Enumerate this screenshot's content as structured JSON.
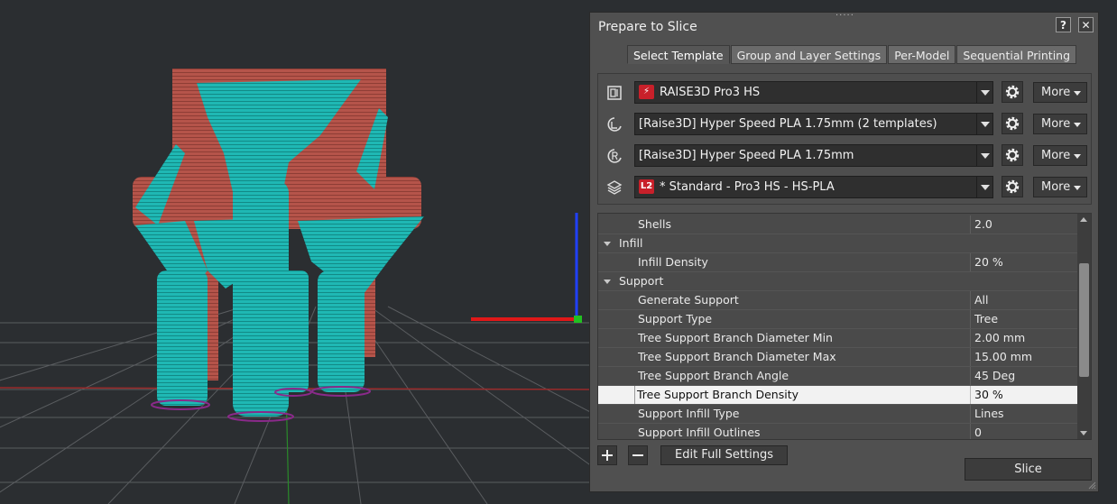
{
  "dialog": {
    "title": "Prepare to Slice",
    "help_label": "?",
    "close_label": "✕",
    "tabs": [
      {
        "label": "Select Template",
        "active": true
      },
      {
        "label": "Group and Layer Settings",
        "active": false
      },
      {
        "label": "Per-Model",
        "active": false
      },
      {
        "label": "Sequential Printing",
        "active": false
      }
    ]
  },
  "templates": {
    "printer": {
      "value": "RAISE3D Pro3 HS",
      "badge": "⚡",
      "icon": "printer-icon",
      "more_label": "More"
    },
    "material": {
      "value": "[Raise3D] Hyper Speed PLA 1.75mm (2 templates)",
      "icon": "material-left-icon",
      "more_label": "More"
    },
    "material_right": {
      "value": "[Raise3D] Hyper Speed PLA 1.75mm",
      "icon": "material-right-icon",
      "more_label": "More"
    },
    "profile": {
      "value": "* Standard - Pro3 HS - HS-PLA",
      "badge": "L2",
      "icon": "layers-icon",
      "more_label": "More"
    }
  },
  "settings": {
    "rows": [
      {
        "type": "setting",
        "label": "Shells",
        "value": "2.0"
      },
      {
        "type": "category",
        "label": "Infill"
      },
      {
        "type": "setting",
        "label": "Infill Density",
        "value": "20 %"
      },
      {
        "type": "category",
        "label": "Support"
      },
      {
        "type": "setting",
        "label": "Generate Support",
        "value": "All"
      },
      {
        "type": "setting",
        "label": "Support Type",
        "value": "Tree"
      },
      {
        "type": "setting",
        "label": "Tree Support Branch Diameter Min",
        "value": "2.00 mm"
      },
      {
        "type": "setting",
        "label": "Tree Support Branch Diameter Max",
        "value": "15.00 mm"
      },
      {
        "type": "setting",
        "label": "Tree Support Branch Angle",
        "value": "45 Deg"
      },
      {
        "type": "setting",
        "label": "Tree Support Branch Density",
        "value": "30 %",
        "selected": true
      },
      {
        "type": "setting",
        "label": "Support Infill Type",
        "value": "Lines"
      },
      {
        "type": "setting",
        "label": "Support Infill Outlines",
        "value": "0"
      }
    ]
  },
  "buttons": {
    "edit_full_settings": "Edit Full Settings",
    "slice": "Slice"
  },
  "colors": {
    "model": "#b5544a",
    "support": "#1fb8b4",
    "viewport_bg": "#2b2e31",
    "selected_row": "#f2f2f2"
  }
}
